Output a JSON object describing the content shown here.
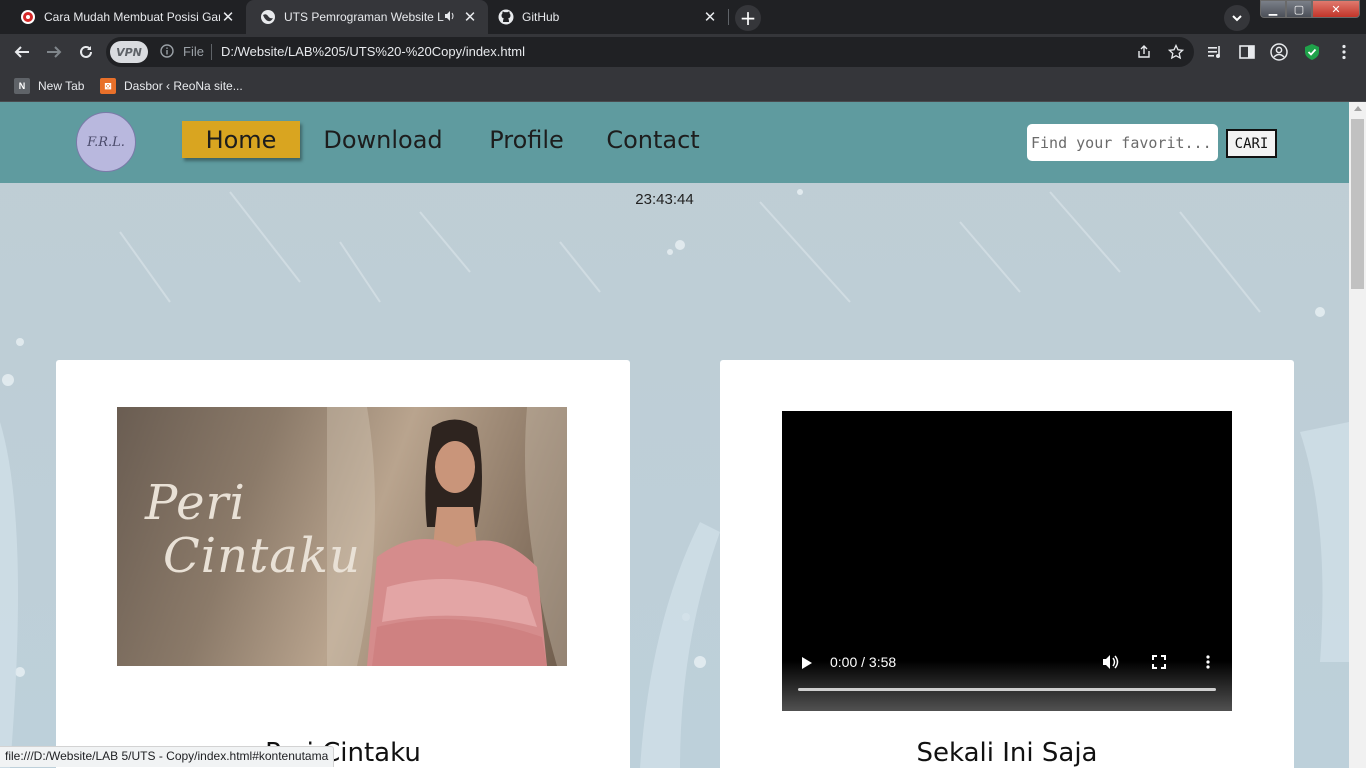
{
  "browser": {
    "tabs": [
      {
        "title": "Cara Mudah Membuat Posisi Gar",
        "active": false
      },
      {
        "title": "UTS Pemrograman Website L",
        "active": true,
        "audio": true
      },
      {
        "title": "GitHub",
        "active": false
      }
    ],
    "new_tab_symbol": "+",
    "vpn_label": "VPN",
    "file_label": "File",
    "url": "D:/Website/LAB%205/UTS%20-%20Copy/index.html",
    "bookmarks": [
      {
        "label": "New Tab",
        "icon_text": "N",
        "icon_color": "#5f6368"
      },
      {
        "label": "Dasbor ‹ ReoNa site...",
        "icon_text": "⊠",
        "icon_color": "#e8702a"
      }
    ],
    "status_url": "file:///D:/Website/LAB 5/UTS - Copy/index.html#kontenutama"
  },
  "site": {
    "logo_text": "F.R.L.",
    "nav": [
      {
        "label": "Home",
        "active": true
      },
      {
        "label": "Download",
        "active": false
      },
      {
        "label": "Profile",
        "active": false
      },
      {
        "label": "Contact",
        "active": false
      }
    ],
    "search": {
      "placeholder": "Find your favorit...",
      "button_label": "CARI"
    },
    "clock": "23:43:44",
    "cards": [
      {
        "cover_title_line1": "Peri",
        "cover_title_line2": "Cintaku",
        "caption": "Peri Cintaku"
      },
      {
        "video_time": "0:00 / 3:58",
        "caption": "Sekali Ini Saja"
      }
    ]
  },
  "colors": {
    "navbar": "#5f9b9f",
    "nav_active": "#d9a520",
    "page_bg": "#bccdd6"
  }
}
